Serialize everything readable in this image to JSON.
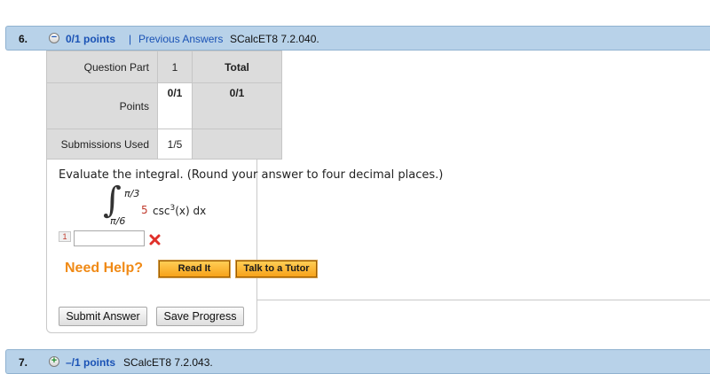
{
  "question6": {
    "number": "6.",
    "status_symbol": "−",
    "points": "0/1 points",
    "separator": "|",
    "previous_answers": "Previous Answers",
    "code": "SCalcET8 7.2.040."
  },
  "scores_table": {
    "row1": {
      "label": "Question Part",
      "part": "1",
      "total": "Total"
    },
    "row2": {
      "label": "Points",
      "part": "0/1",
      "total": "0/1"
    },
    "row3": {
      "label": "Submissions Used",
      "part": "1/5"
    }
  },
  "problem": {
    "prompt": "Evaluate the integral. (Round your answer to four decimal places.)",
    "integral_sign": "∫",
    "upper_limit": "π/3",
    "lower_limit": "π/6",
    "coefficient": "5",
    "func_left": "csc",
    "exponent": "3",
    "func_right": "(x) dx"
  },
  "answer": {
    "part_number": "1",
    "value": "",
    "status_icon": "x-mark-icon"
  },
  "help": {
    "label": "Need Help?",
    "read_it": "Read It",
    "talk_to_tutor": "Talk to a Tutor"
  },
  "actions": {
    "submit": "Submit Answer",
    "save": "Save Progress"
  },
  "question7": {
    "number": "7.",
    "status_symbol": "+",
    "points": "–/1 points",
    "code": "SCalcET8 7.2.043."
  },
  "colors": {
    "header_bar": "#b8d2e9",
    "link_blue": "#1a52b5",
    "help_orange": "#f08a16",
    "error_red": "#e0302a"
  }
}
